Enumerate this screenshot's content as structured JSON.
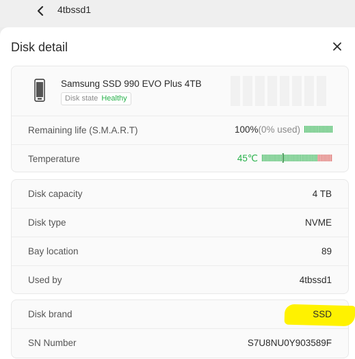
{
  "topbar": {
    "back_icon": "chevron-left-icon",
    "title": "4tbssd1"
  },
  "panel": {
    "title": "Disk detail",
    "close_icon": "close-icon"
  },
  "disk": {
    "name": "Samsung SSD 990 EVO Plus 4TB",
    "state_label": "Disk state",
    "state_value": "Healthy",
    "icon": "ssd-icon"
  },
  "health": {
    "remaining_life_label": "Remaining life (S.M.A.R.T)",
    "remaining_life_value": "100%",
    "remaining_life_used": "(0% used)",
    "temperature_label": "Temperature",
    "temperature_value": "45℃"
  },
  "info": {
    "capacity_label": "Disk capacity",
    "capacity_value": "4 TB",
    "type_label": "Disk type",
    "type_value": "NVME",
    "bay_label": "Bay location",
    "bay_value": "89",
    "used_by_label": "Used by",
    "used_by_value": "4tbssd1"
  },
  "identity": {
    "brand_label": "Disk brand",
    "brand_value": "SSD",
    "sn_label": "SN Number",
    "sn_value": "S7U8NU0Y903589F"
  },
  "colors": {
    "accent_green": "#27b14a",
    "warn_red": "#d9534f",
    "highlight": "#fff200"
  }
}
